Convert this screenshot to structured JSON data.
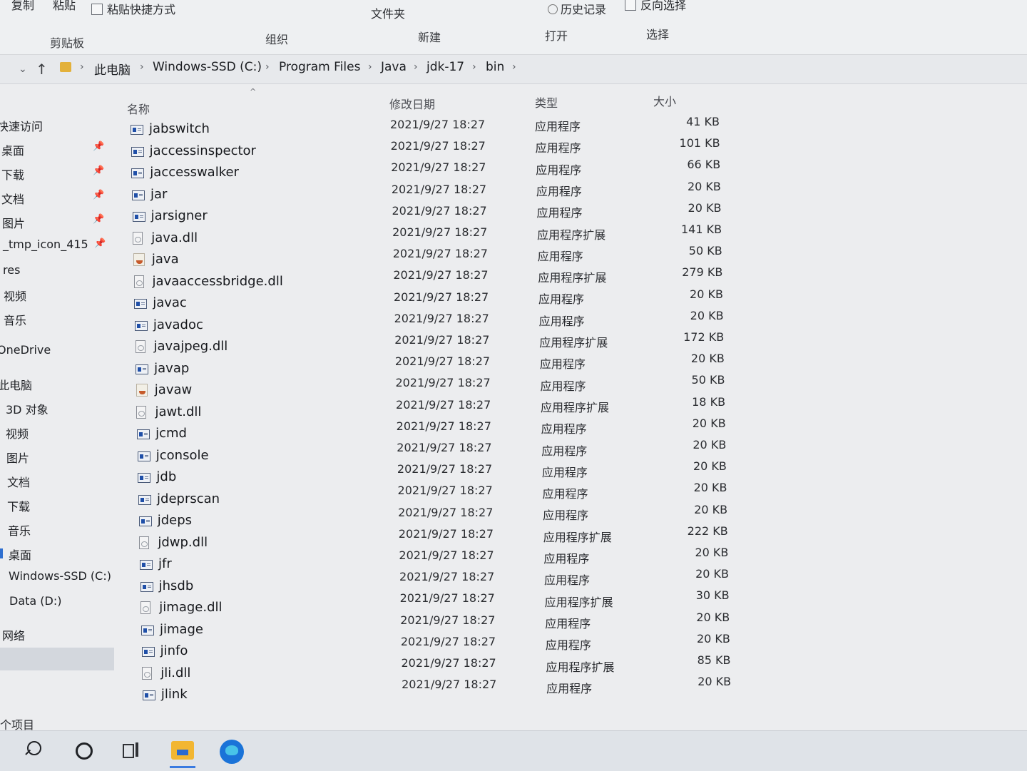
{
  "ribbon": {
    "top_labels": {
      "copy": "复制",
      "paste": "粘贴",
      "paste_shortcut": "粘贴快捷方式",
      "folder": "文件夹",
      "history": "历史记录",
      "invert_selection": "反向选择"
    },
    "groups": {
      "clipboard": "剪贴板",
      "organize": "组织",
      "new": "新建",
      "open": "打开",
      "select": "选择"
    }
  },
  "address": {
    "crumbs": [
      "此电脑",
      "Windows-SSD (C:)",
      "Program Files",
      "Java",
      "jdk-17",
      "bin"
    ]
  },
  "sidebar": {
    "quick_access": "快速访问",
    "items": [
      {
        "label": "桌面",
        "pinned": true
      },
      {
        "label": "下载",
        "pinned": true
      },
      {
        "label": "文档",
        "pinned": true
      },
      {
        "label": "图片",
        "pinned": true
      },
      {
        "label": "_tmp_icon_415",
        "pinned": true
      },
      {
        "label": "res",
        "pinned": false
      },
      {
        "label": "视频",
        "pinned": false
      },
      {
        "label": "音乐",
        "pinned": false
      }
    ],
    "onedrive": "OneDrive",
    "this_pc": "此电脑",
    "pc_items": [
      "3D 对象",
      "视频",
      "图片",
      "文档",
      "下载",
      "音乐",
      "桌面"
    ],
    "drive_c": "Windows-SSD (C:)",
    "drive_d": "Data (D:)",
    "network": "网络"
  },
  "columns": {
    "name": "名称",
    "date": "修改日期",
    "type": "类型",
    "size": "大小"
  },
  "files": [
    {
      "name": "jabswitch",
      "date": "2021/9/27 18:27",
      "type": "应用程序",
      "size": "41 KB",
      "icon": "exe-icon"
    },
    {
      "name": "jaccessinspector",
      "date": "2021/9/27 18:27",
      "type": "应用程序",
      "size": "101 KB",
      "icon": "exe-icon"
    },
    {
      "name": "jaccesswalker",
      "date": "2021/9/27 18:27",
      "type": "应用程序",
      "size": "66 KB",
      "icon": "exe-icon"
    },
    {
      "name": "jar",
      "date": "2021/9/27 18:27",
      "type": "应用程序",
      "size": "20 KB",
      "icon": "exe-icon"
    },
    {
      "name": "jarsigner",
      "date": "2021/9/27 18:27",
      "type": "应用程序",
      "size": "20 KB",
      "icon": "exe-icon"
    },
    {
      "name": "java.dll",
      "date": "2021/9/27 18:27",
      "type": "应用程序扩展",
      "size": "141 KB",
      "icon": "dll-icon"
    },
    {
      "name": "java",
      "date": "2021/9/27 18:27",
      "type": "应用程序",
      "size": "50 KB",
      "icon": "java-icon"
    },
    {
      "name": "javaaccessbridge.dll",
      "date": "2021/9/27 18:27",
      "type": "应用程序扩展",
      "size": "279 KB",
      "icon": "dll-icon"
    },
    {
      "name": "javac",
      "date": "2021/9/27 18:27",
      "type": "应用程序",
      "size": "20 KB",
      "icon": "exe-icon"
    },
    {
      "name": "javadoc",
      "date": "2021/9/27 18:27",
      "type": "应用程序",
      "size": "20 KB",
      "icon": "exe-icon"
    },
    {
      "name": "javajpeg.dll",
      "date": "2021/9/27 18:27",
      "type": "应用程序扩展",
      "size": "172 KB",
      "icon": "dll-icon"
    },
    {
      "name": "javap",
      "date": "2021/9/27 18:27",
      "type": "应用程序",
      "size": "20 KB",
      "icon": "exe-icon"
    },
    {
      "name": "javaw",
      "date": "2021/9/27 18:27",
      "type": "应用程序",
      "size": "50 KB",
      "icon": "java-icon"
    },
    {
      "name": "jawt.dll",
      "date": "2021/9/27 18:27",
      "type": "应用程序扩展",
      "size": "18 KB",
      "icon": "dll-icon"
    },
    {
      "name": "jcmd",
      "date": "2021/9/27 18:27",
      "type": "应用程序",
      "size": "20 KB",
      "icon": "exe-icon"
    },
    {
      "name": "jconsole",
      "date": "2021/9/27 18:27",
      "type": "应用程序",
      "size": "20 KB",
      "icon": "exe-icon"
    },
    {
      "name": "jdb",
      "date": "2021/9/27 18:27",
      "type": "应用程序",
      "size": "20 KB",
      "icon": "exe-icon"
    },
    {
      "name": "jdeprscan",
      "date": "2021/9/27 18:27",
      "type": "应用程序",
      "size": "20 KB",
      "icon": "exe-icon"
    },
    {
      "name": "jdeps",
      "date": "2021/9/27 18:27",
      "type": "应用程序",
      "size": "20 KB",
      "icon": "exe-icon"
    },
    {
      "name": "jdwp.dll",
      "date": "2021/9/27 18:27",
      "type": "应用程序扩展",
      "size": "222 KB",
      "icon": "dll-icon"
    },
    {
      "name": "jfr",
      "date": "2021/9/27 18:27",
      "type": "应用程序",
      "size": "20 KB",
      "icon": "exe-icon"
    },
    {
      "name": "jhsdb",
      "date": "2021/9/27 18:27",
      "type": "应用程序",
      "size": "20 KB",
      "icon": "exe-icon"
    },
    {
      "name": "jimage.dll",
      "date": "2021/9/27 18:27",
      "type": "应用程序扩展",
      "size": "30 KB",
      "icon": "dll-icon"
    },
    {
      "name": "jimage",
      "date": "2021/9/27 18:27",
      "type": "应用程序",
      "size": "20 KB",
      "icon": "exe-icon"
    },
    {
      "name": "jinfo",
      "date": "2021/9/27 18:27",
      "type": "应用程序",
      "size": "20 KB",
      "icon": "exe-icon"
    },
    {
      "name": "jli.dll",
      "date": "2021/9/27 18:27",
      "type": "应用程序扩展",
      "size": "85 KB",
      "icon": "dll-icon"
    },
    {
      "name": "jlink",
      "date": "2021/9/27 18:27",
      "type": "应用程序",
      "size": "20 KB",
      "icon": "exe-icon"
    }
  ],
  "status": {
    "items_label": "个项目"
  },
  "taskbar": {
    "icons": [
      "search-icon",
      "cortana-icon",
      "task-view-icon",
      "file-explorer-icon",
      "edge-icon"
    ]
  },
  "colors": {
    "accent": "#2f6fd0",
    "folder": "#e3b13a",
    "sidebar_selected": "#d3d7dd"
  }
}
